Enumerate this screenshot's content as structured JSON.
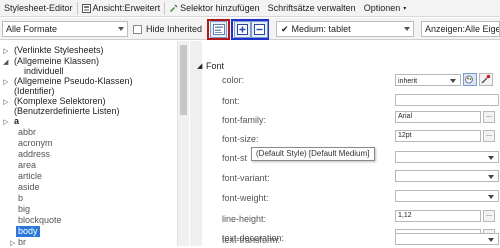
{
  "menu": {
    "items": [
      "Stylesheet-Editor",
      "Ansicht:Erweitert",
      "Selektor hinzufügen",
      "Schriftsätze verwalten",
      "Optionen"
    ]
  },
  "toolbar": {
    "format_combo": "Alle Formate",
    "hide_inherited": "Hide Inherited",
    "medium_checked": true,
    "medium_combo": "Medium: tablet",
    "view_combo": "Anzeigen:Alle Eigensc"
  },
  "tree": {
    "items": [
      "(Verlinkte Stylesheets)",
      "(Allgemeine Klassen)",
      "individuell",
      "(Allgemeine Pseudo-Klassen)",
      "(Identifier)",
      "(Komplexe Selektoren)",
      "(Benutzerdefinierte Listen)",
      "a",
      "abbr",
      "acronym",
      "address",
      "area",
      "article",
      "aside",
      "b",
      "big",
      "blockquote",
      "body",
      "br"
    ]
  },
  "props": {
    "section": "Font",
    "labels": [
      "color:",
      "font:",
      "font-family:",
      "font-size:",
      "font-st",
      "font-variant:",
      "font-weight:",
      "line-height:",
      "text-decoration:",
      "text-transform:"
    ],
    "color_value": "inherit",
    "family_value": "Arial",
    "size_value": "12pt",
    "lineheight_value": "1,12",
    "dots": "..."
  },
  "tooltip": "(Default Style)  [Default Medium]",
  "colors": {
    "selection": "#2b78d8",
    "highlight_red": "#b01818",
    "highlight_blue": "#2030c8"
  }
}
